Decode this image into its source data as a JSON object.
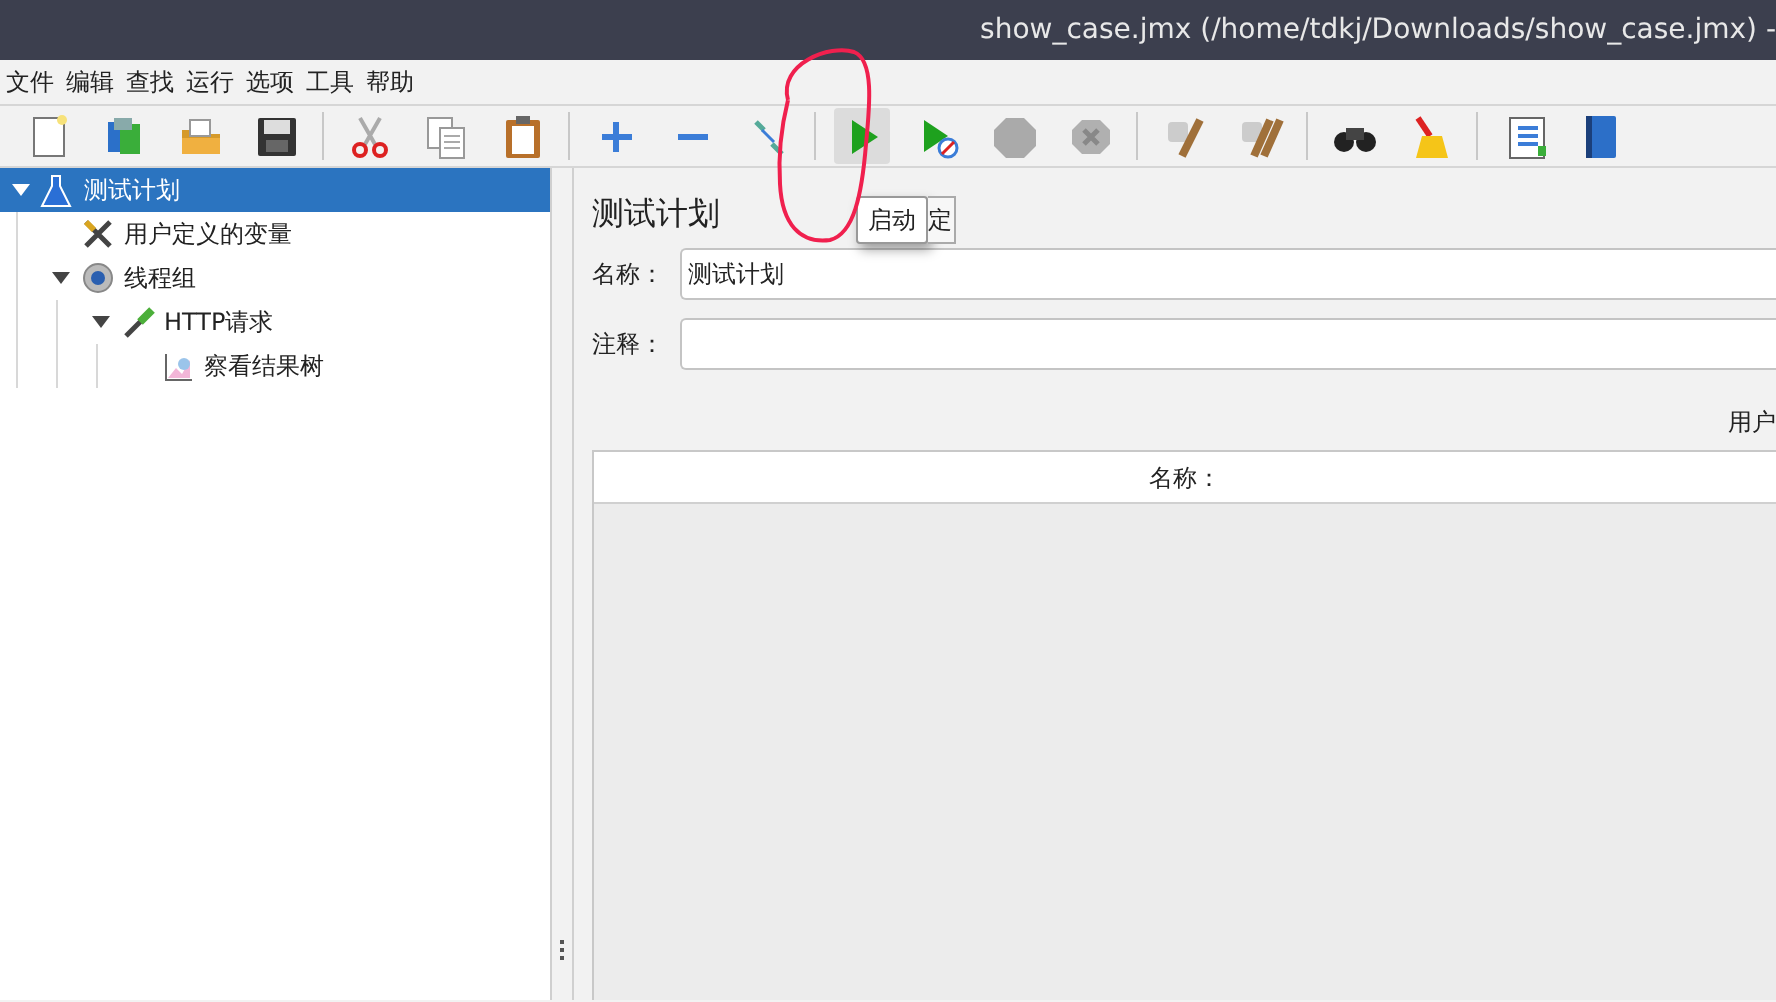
{
  "window": {
    "title": "show_case.jmx (/home/tdkj/Downloads/show_case.jmx) -"
  },
  "menu": [
    {
      "label": "文件"
    },
    {
      "label": "编辑"
    },
    {
      "label": "查找"
    },
    {
      "label": "运行"
    },
    {
      "label": "选项"
    },
    {
      "label": "工具"
    },
    {
      "label": "帮助"
    }
  ],
  "toolbar": [
    [
      {
        "kind": "new",
        "hovered": false
      },
      {
        "kind": "templates",
        "hovered": false
      },
      {
        "kind": "open",
        "hovered": false
      },
      {
        "kind": "save",
        "hovered": false
      }
    ],
    [
      {
        "kind": "cut",
        "hovered": false
      },
      {
        "kind": "copy",
        "hovered": false
      },
      {
        "kind": "paste",
        "hovered": false
      }
    ],
    [
      {
        "kind": "expand",
        "hovered": false
      },
      {
        "kind": "collapse",
        "hovered": false
      },
      {
        "kind": "toggle",
        "hovered": false
      }
    ],
    [
      {
        "kind": "start",
        "hovered": true
      },
      {
        "kind": "start_no_timers",
        "hovered": false
      },
      {
        "kind": "stop",
        "hovered": false
      },
      {
        "kind": "shutdown",
        "hovered": false
      }
    ],
    [
      {
        "kind": "clear",
        "hovered": false
      },
      {
        "kind": "clear_all",
        "hovered": false
      }
    ],
    [
      {
        "kind": "search",
        "hovered": false
      },
      {
        "kind": "reset",
        "hovered": false
      }
    ],
    [
      {
        "kind": "list",
        "hovered": false
      },
      {
        "kind": "help",
        "hovered": false
      }
    ]
  ],
  "tree": [
    {
      "label": "测试计划",
      "kind": "plan",
      "selected": true,
      "expanded": true,
      "children": [
        {
          "label": "用户定义的变量",
          "kind": "variables",
          "selected": false
        },
        {
          "label": "线程组",
          "kind": "thread_group",
          "selected": false,
          "expanded": true,
          "children": [
            {
              "label": "HTTP请求",
              "kind": "sampler",
              "selected": false,
              "expanded": true,
              "children": [
                {
                  "label": "察看结果树",
                  "kind": "listener",
                  "selected": false
                }
              ]
            }
          ]
        }
      ]
    }
  ],
  "panel": {
    "title": "测试计划",
    "fields": [
      {
        "label": "名称：",
        "value": "测试计划"
      },
      {
        "label": "注释："
      }
    ],
    "section_label": "用户",
    "table": {
      "columns": [
        "名称："
      ]
    }
  },
  "tooltip": {
    "text": "启动",
    "behind": "定"
  },
  "annotation": {
    "kind": "freehand_loop"
  }
}
